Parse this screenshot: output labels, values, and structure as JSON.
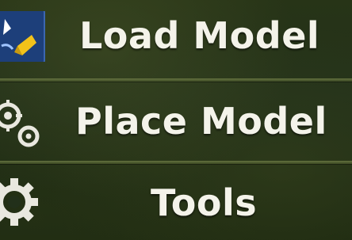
{
  "menu": {
    "items": [
      {
        "label": "Load Model",
        "icon": "load-model-icon"
      },
      {
        "label": "Place Model",
        "icon": "place-model-icon"
      },
      {
        "label": "Tools",
        "icon": "gear-icon"
      }
    ]
  },
  "colors": {
    "background": "#22301a",
    "divider": "#6e7c46",
    "text": "#f4f3ea",
    "icon_tile": "#1d3f7a",
    "icon_accent": "#f2c21a"
  }
}
